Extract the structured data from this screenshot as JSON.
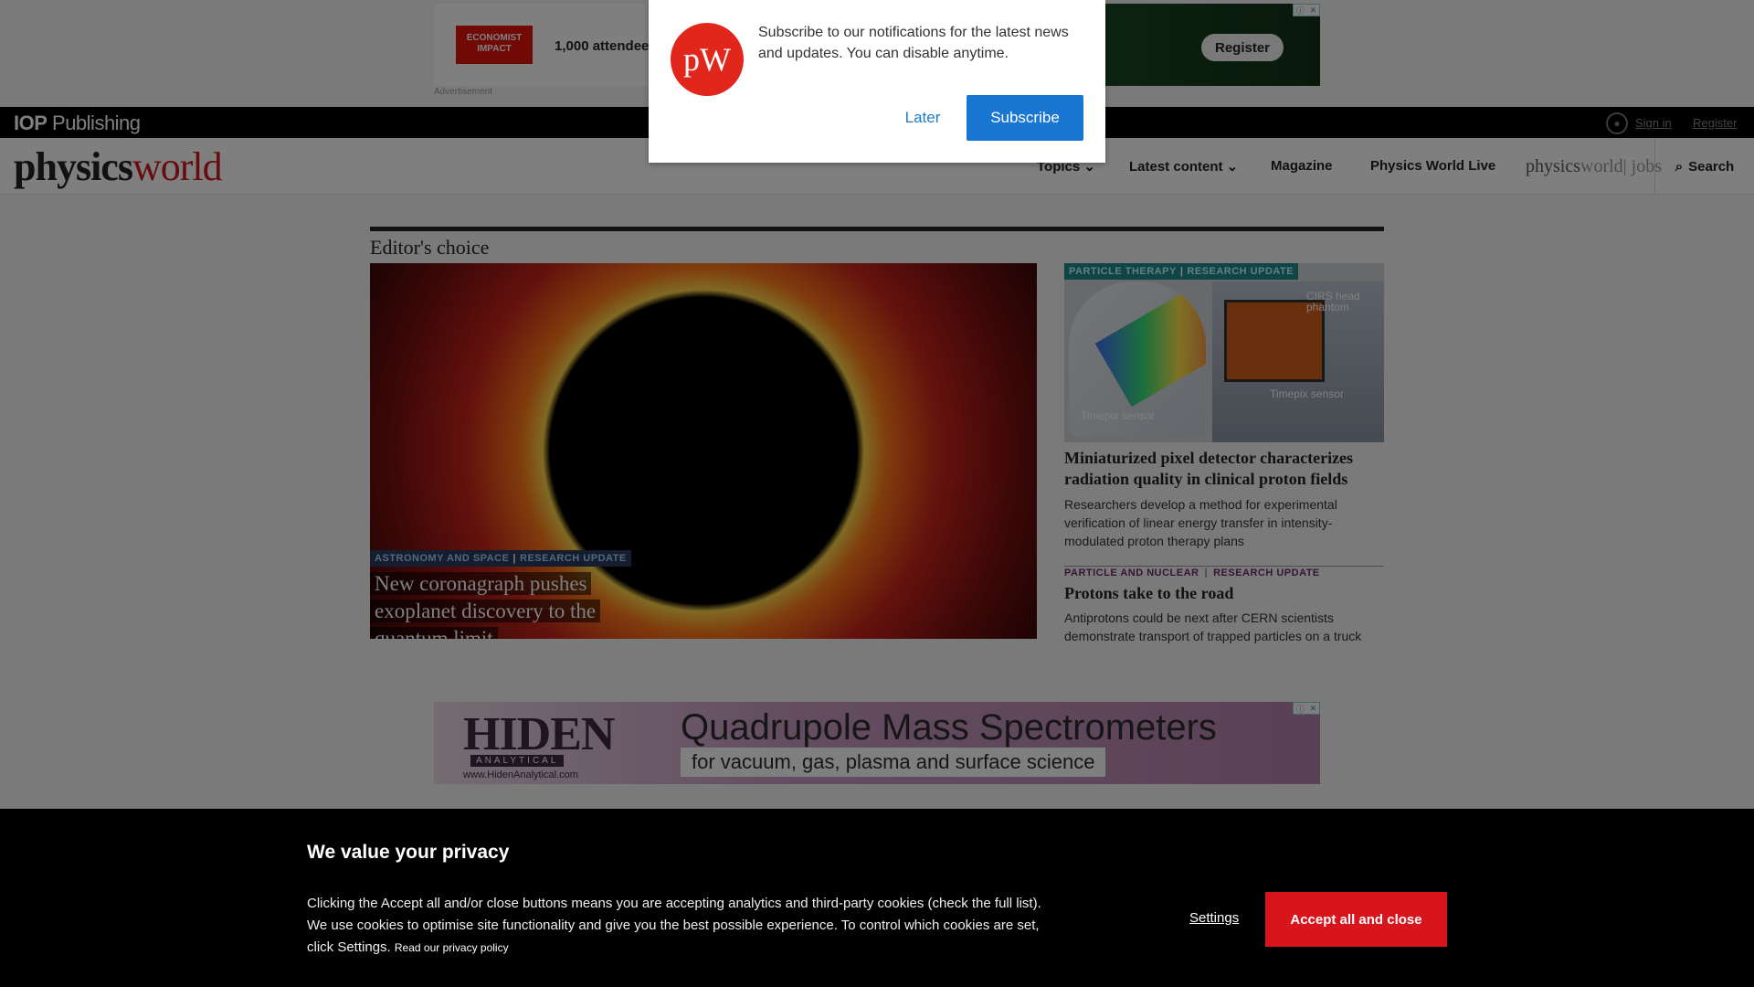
{
  "top_ad": {
    "brand": "ECONOMIST IMPACT",
    "text": "1,000 attendee",
    "register_label": "Register",
    "label": "Advertisement"
  },
  "iop_bar": {
    "logo_bold": "IOP",
    "logo_text": " Publishing",
    "signin": "Sign in",
    "register": "Register"
  },
  "nav": {
    "logo_physics": "physics",
    "logo_world": "world",
    "items": [
      {
        "label": "Topics ⌄"
      },
      {
        "label": "Latest content ⌄"
      },
      {
        "label": "Magazine"
      },
      {
        "label": "Physics World Live"
      }
    ],
    "jobs_physics": "physics",
    "jobs_world": "world",
    "jobs_label": "| jobs",
    "search_label": "Search"
  },
  "editors_choice": {
    "title": "Editor's choice",
    "hero": {
      "tag1": "ASTRONOMY AND SPACE",
      "tag2": "RESEARCH UPDATE",
      "title": "New coronagraph pushes exoplanet discovery to the quantum limit"
    },
    "side": {
      "tag1": "PARTICLE THERAPY",
      "tag2": "RESEARCH UPDATE",
      "img_label_left": "Timepix sensor",
      "img_label_right": "Timepix sensor",
      "img_label_cirs": "CIRS head phantom",
      "title": "Miniaturized pixel detector characterizes radiation quality in clinical proton fields",
      "desc": "Researchers develop a method for experimental verification of linear energy transfer in intensity-modulated proton therapy plans"
    },
    "card2": {
      "tag1": "PARTICLE AND NUCLEAR",
      "tag2": "RESEARCH UPDATE",
      "title": "Protons take to the road",
      "desc": "Antiprotons could be next after CERN scientists demonstrate transport of trapped particles on a truck"
    }
  },
  "bottom_ad": {
    "logo": "HIDEN",
    "logo_sub": "ANALYTICAL",
    "url": "www.HidenAnalytical.com",
    "headline": "Quadrupole Mass Spectrometers",
    "subline": "for vacuum, gas, plasma and surface science"
  },
  "notification": {
    "icon_text": "pW",
    "message": "Subscribe to our notifications for the latest news and updates. You can disable anytime.",
    "later": "Later",
    "subscribe": "Subscribe"
  },
  "cookie": {
    "title": "We value your privacy",
    "text": "Clicking the Accept all and/or close buttons means you are accepting analytics and third-party cookies (check the full list). We use cookies to optimise site functionality and give you the best possible experience. To control which cookies are set, click Settings.",
    "privacy_link": "Read our privacy policy",
    "settings": "Settings",
    "accept": "Accept all and close"
  }
}
